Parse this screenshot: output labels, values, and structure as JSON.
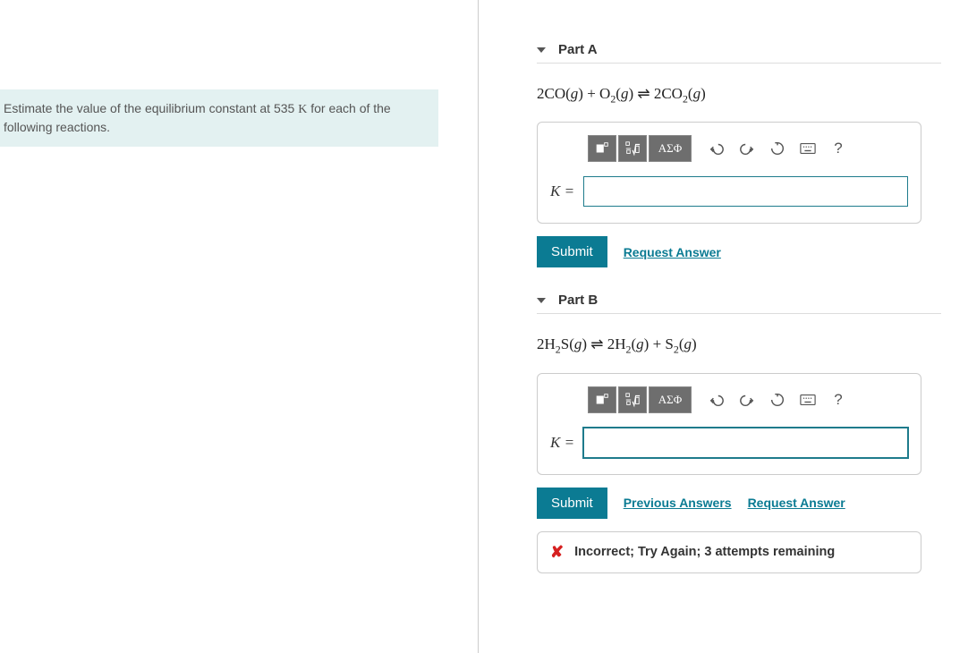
{
  "prompt": {
    "line1": "Estimate the value of the equilibrium constant at 535 ",
    "tempSymbol": "K",
    "line1_tail": " for each of the",
    "line2": "following reactions."
  },
  "parts": [
    {
      "title": "Part A",
      "equation_html": "2CO(<i>g</i>) + O<sub>2</sub>(<i>g</i>) &#8652; 2CO<sub>2</sub>(<i>g</i>)",
      "k_label": "K =",
      "input_value": "",
      "submit": "Submit",
      "links": [
        "Request Answer"
      ],
      "feedback": null,
      "input_focused": false
    },
    {
      "title": "Part B",
      "equation_html": "2H<sub>2</sub>S(<i>g</i>) &#8652; 2H<sub>2</sub>(<i>g</i>) + S<sub>2</sub>(<i>g</i>)",
      "k_label": "K =",
      "input_value": "",
      "submit": "Submit",
      "links": [
        "Previous Answers",
        "Request Answer"
      ],
      "feedback": "Incorrect; Try Again; 3 attempts remaining",
      "input_focused": true
    }
  ],
  "toolbar": {
    "template_icon": "template-icon",
    "fraction_icon": "fraction-root-icon",
    "greek_label": "ΑΣΦ",
    "undo": "undo-icon",
    "redo": "redo-icon",
    "reset": "reset-icon",
    "keyboard": "keyboard-icon",
    "help": "?"
  }
}
